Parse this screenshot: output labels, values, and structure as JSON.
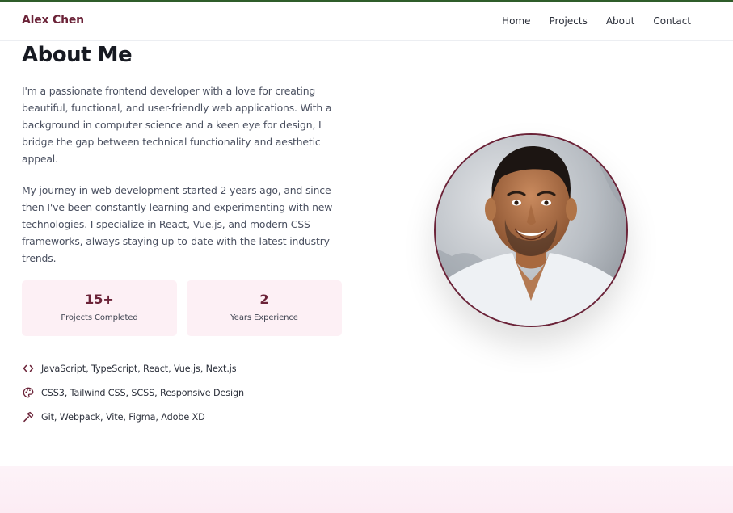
{
  "brand": "Alex Chen",
  "nav": [
    {
      "label": "Home"
    },
    {
      "label": "Projects"
    },
    {
      "label": "About"
    },
    {
      "label": "Contact"
    }
  ],
  "about": {
    "title": "About Me",
    "paragraphs": [
      "I'm a passionate frontend developer with a love for creating beautiful, functional, and user-friendly web applications. With a background in computer science and a keen eye for design, I bridge the gap between technical functionality and aesthetic appeal.",
      "My journey in web development started 2 years ago, and since then I've been constantly learning and experimenting with new technologies. I specialize in React, Vue.js, and modern CSS frameworks, always staying up-to-date with the latest industry trends."
    ],
    "stats": [
      {
        "value": "15+",
        "label": "Projects Completed"
      },
      {
        "value": "2",
        "label": "Years Experience"
      }
    ],
    "skills": [
      {
        "icon": "code-icon",
        "text": "JavaScript, TypeScript, React, Vue.js, Next.js"
      },
      {
        "icon": "palette-icon",
        "text": "CSS3, Tailwind CSS, SCSS, Responsive Design"
      },
      {
        "icon": "tools-icon",
        "text": "Git, Webpack, Vite, Figma, Adobe XD"
      }
    ]
  },
  "colors": {
    "brand": "#6b2338",
    "card_bg": "#fdf0f5",
    "heading": "#171a22",
    "body_text": "#4a5060"
  }
}
